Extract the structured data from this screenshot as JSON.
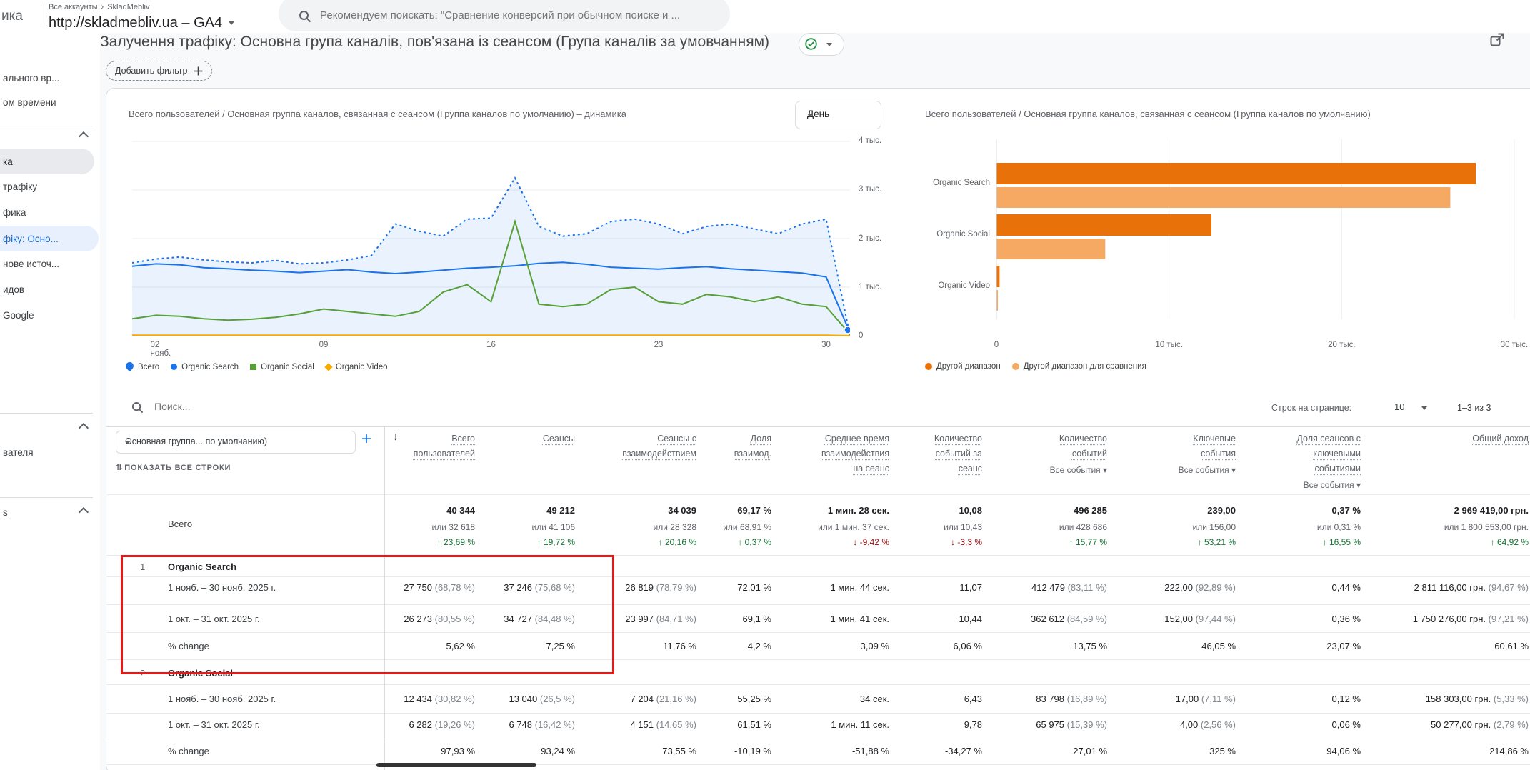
{
  "topbar": {
    "logo_fragment": "ика",
    "breadcrumb": {
      "root": "Все аккаунты",
      "separator": "›",
      "account": "SkladMebliv"
    },
    "property": "http://skladmebliv.ua – GA4",
    "search_placeholder": "Рекомендуем поискать: \"Сравнение конверсий при обычном поиске и ..."
  },
  "sidebar": {
    "items": [
      {
        "label": "ального вр...",
        "variant": "plain"
      },
      {
        "label": "ом времени",
        "variant": "plain"
      },
      {
        "variant": "divider"
      },
      {
        "variant": "chevron"
      },
      {
        "label": "ка",
        "variant": "active-gray"
      },
      {
        "label": "трафіку",
        "variant": "plain"
      },
      {
        "label": "фика",
        "variant": "plain"
      },
      {
        "label": "фіку: Осно...",
        "variant": "active-blue"
      },
      {
        "label": "нове источ...",
        "variant": "plain"
      },
      {
        "label": "идов",
        "variant": "plain"
      },
      {
        "label": "Google",
        "variant": "plain"
      },
      {
        "variant": "divider"
      },
      {
        "variant": "chevron"
      },
      {
        "label": "вателя",
        "variant": "plain"
      },
      {
        "variant": "divider"
      },
      {
        "label": "s",
        "variant": "chevron-label"
      }
    ]
  },
  "page": {
    "title": "Залучення трафіку: Основна група каналів, пов'язана із сеансом (Група каналів за умовчанням)",
    "add_filter_label": "Добавить фильтр"
  },
  "charts": {
    "left_title": "Всего пользователей / Основная группа каналов, связанная с сеансом (Группа каналов по умолчанию) – динамика",
    "granularity": "День",
    "right_title": "Всего пользователей / Основная группа каналов, связанная с сеансом (Группа каналов по умолчанию)",
    "left_legend": [
      "Всего",
      "Organic Search",
      "Organic Social",
      "Organic Video"
    ],
    "right_legend": [
      "Другой диапазон",
      "Другой диапазон для сравнения"
    ]
  },
  "chart_data": [
    {
      "type": "line",
      "title": "Всего пользователей / Основная группа каналов, связанная с сеансом (Группа каналов по умолчанию) – динамика",
      "x_axis": {
        "ticks": [
          "02 нояб.",
          "09",
          "16",
          "23",
          "30"
        ],
        "tick_days": [
          2,
          9,
          16,
          23,
          30
        ],
        "days": 31
      },
      "y_axis": {
        "ticks": [
          "0",
          "1 тыс.",
          "2 тыс.",
          "3 тыс.",
          "4 тыс."
        ],
        "max": 4000
      },
      "series": [
        {
          "name": "Всего",
          "style": "dashed",
          "fill": true,
          "color": "#1a73e8",
          "values": [
            1500,
            1580,
            1620,
            1560,
            1520,
            1500,
            1550,
            1480,
            1500,
            1560,
            1650,
            2300,
            2150,
            2050,
            2400,
            2420,
            3250,
            2250,
            2050,
            2100,
            2350,
            2400,
            2300,
            2100,
            2250,
            2300,
            2200,
            2100,
            2300,
            2400,
            0
          ]
        },
        {
          "name": "Organic Search",
          "style": "solid",
          "color": "#1a73e8",
          "values": [
            1430,
            1480,
            1460,
            1400,
            1380,
            1350,
            1330,
            1300,
            1330,
            1360,
            1310,
            1280,
            1310,
            1350,
            1390,
            1410,
            1440,
            1490,
            1510,
            1470,
            1410,
            1390,
            1370,
            1400,
            1420,
            1380,
            1350,
            1320,
            1290,
            1210,
            60
          ]
        },
        {
          "name": "Organic Social",
          "style": "solid",
          "color": "#57a037",
          "values": [
            350,
            420,
            400,
            350,
            320,
            340,
            380,
            450,
            550,
            500,
            450,
            400,
            500,
            900,
            1050,
            700,
            2350,
            650,
            600,
            650,
            950,
            1000,
            700,
            650,
            850,
            800,
            700,
            800,
            650,
            600,
            30
          ]
        },
        {
          "name": "Organic Video",
          "style": "solid",
          "color": "#f9ab00",
          "values": [
            10,
            10,
            10,
            10,
            10,
            10,
            10,
            10,
            10,
            10,
            10,
            10,
            10,
            10,
            10,
            10,
            10,
            10,
            10,
            10,
            10,
            10,
            10,
            10,
            10,
            10,
            10,
            10,
            10,
            10,
            0
          ]
        }
      ]
    },
    {
      "type": "bar",
      "orientation": "horizontal",
      "title": "Всего пользователей / Основная группа каналов, связанная с сеансом (Группа каналов по умолчанию)",
      "categories": [
        "Organic Search",
        "Organic Social",
        "Organic Video"
      ],
      "series": [
        {
          "name": "Другой диапазон",
          "color": "#e8710a",
          "values": [
            27750,
            12434,
            160
          ]
        },
        {
          "name": "Другой диапазон для сравнения",
          "color": "#f6a962",
          "values": [
            26273,
            6282,
            63
          ]
        }
      ],
      "x_axis": {
        "ticks": [
          "0",
          "10 тыс.",
          "20 тыс.",
          "30 тыс."
        ],
        "max": 30000
      }
    }
  ],
  "table": {
    "search_placeholder": "Поиск...",
    "rows_per_page_label": "Строк на странице:",
    "rows_per_page_value": "10",
    "pagination": "1–3 из 3",
    "dimension_selector": "Основная группа... по умолчанию)",
    "show_all_label": "ПОКАЗАТЬ ВСЕ СТРОКИ",
    "headers": [
      {
        "lines": [
          "Всего",
          "пользователей"
        ],
        "sorted": true
      },
      {
        "lines": [
          "Сеансы"
        ]
      },
      {
        "lines": [
          "Сеансы с",
          "взаимодействием"
        ]
      },
      {
        "lines": [
          "Доля",
          "взаимод."
        ]
      },
      {
        "lines": [
          "Среднее время",
          "взаимодействия",
          "на сеанс"
        ]
      },
      {
        "lines": [
          "Количество",
          "событий за",
          "сеанс"
        ]
      },
      {
        "lines": [
          "Количество",
          "событий"
        ],
        "sub": "Все события"
      },
      {
        "lines": [
          "Ключевые",
          "события"
        ],
        "sub": "Все события"
      },
      {
        "lines": [
          "Доля сеансов с",
          "ключевыми",
          "событиями"
        ],
        "sub": "Все события"
      },
      {
        "lines": [
          "Общий доход"
        ]
      }
    ],
    "totals": {
      "label": "Всего",
      "cells": [
        {
          "main": "40 344",
          "alt": "или 32 618",
          "change": "23,69 %",
          "dir": "up"
        },
        {
          "main": "49 212",
          "alt": "или 41 106",
          "change": "19,72 %",
          "dir": "up"
        },
        {
          "main": "34 039",
          "alt": "или 28 328",
          "change": "20,16 %",
          "dir": "up"
        },
        {
          "main": "69,17 %",
          "alt": "или 68,91 %",
          "change": "0,37 %",
          "dir": "up"
        },
        {
          "main": "1 мин. 28 сек.",
          "alt": "или 1 мин. 37 сек.",
          "change": "-9,42 %",
          "dir": "down"
        },
        {
          "main": "10,08",
          "alt": "или 10,43",
          "change": "-3,3 %",
          "dir": "down"
        },
        {
          "main": "496 285",
          "alt": "или 428 686",
          "change": "15,77 %",
          "dir": "up"
        },
        {
          "main": "239,00",
          "alt": "или 156,00",
          "change": "53,21 %",
          "dir": "up"
        },
        {
          "main": "0,37 %",
          "alt": "или 0,31 %",
          "change": "16,55 %",
          "dir": "up"
        },
        {
          "main": "2 969 419,00 грн.",
          "alt": "или 1 800 553,00 грн.",
          "change": "64,92 %",
          "dir": "up"
        }
      ]
    },
    "groups": [
      {
        "index": "1",
        "name": "Organic Search",
        "rows": [
          {
            "label": "1 нояб. – 30 нояб. 2025 г.",
            "values": [
              "27 750 (68,78 %)",
              "37 246 (75,68 %)",
              "26 819 (78,79 %)",
              "72,01 %",
              "1 мин. 44 сек.",
              "11,07",
              "412 479 (83,11 %)",
              "222,00 (92,89 %)",
              "0,44 %",
              "2 811 116,00 грн. (94,67 %)"
            ]
          },
          {
            "label": "1 окт. – 31 окт. 2025 г.",
            "values": [
              "26 273 (80,55 %)",
              "34 727 (84,48 %)",
              "23 997 (84,71 %)",
              "69,1 %",
              "1 мин. 41 сек.",
              "10,44",
              "362 612 (84,59 %)",
              "152,00 (97,44 %)",
              "0,36 %",
              "1 750 276,00 грн. (97,21 %)"
            ]
          },
          {
            "label": "% change",
            "values": [
              "5,62 %",
              "7,25 %",
              "11,76 %",
              "4,2 %",
              "3,09 %",
              "6,06 %",
              "13,75 %",
              "46,05 %",
              "23,07 %",
              "60,61 %"
            ]
          }
        ]
      },
      {
        "index": "2",
        "name": "Organic Social",
        "rows": [
          {
            "label": "1 нояб. – 30 нояб. 2025 г.",
            "values": [
              "12 434 (30,82 %)",
              "13 040 (26,5 %)",
              "7 204 (21,16 %)",
              "55,25 %",
              "34 сек.",
              "6,43",
              "83 798 (16,89 %)",
              "17,00 (7,11 %)",
              "0,12 %",
              "158 303,00 грн. (5,33 %)"
            ]
          },
          {
            "label": "1 окт. – 31 окт. 2025 г.",
            "values": [
              "6 282 (19,26 %)",
              "6 748 (16,42 %)",
              "4 151 (14,65 %)",
              "61,51 %",
              "1 мин. 11 сек.",
              "9,78",
              "65 975 (15,39 %)",
              "4,00 (2,56 %)",
              "0,06 %",
              "50 277,00 грн. (2,79 %)"
            ]
          },
          {
            "label": "% change",
            "values": [
              "97,93 %",
              "93,24 %",
              "73,55 %",
              "-10,19 %",
              "-51,88 %",
              "-34,27 %",
              "27,01 %",
              "325 %",
              "94,06 %",
              "214,86 %"
            ]
          }
        ]
      }
    ]
  },
  "colors": {
    "blue": "#1a73e8",
    "green_line": "#57a037",
    "orange_line": "#f9ab00",
    "bar_dark": "#e8710a",
    "bar_light": "#f6a962",
    "positive": "#137333",
    "negative": "#a50e0e",
    "annotation_red": "#e11b17",
    "active_item_bg": "#e8f0fe",
    "active_item_text": "#1967d2"
  }
}
